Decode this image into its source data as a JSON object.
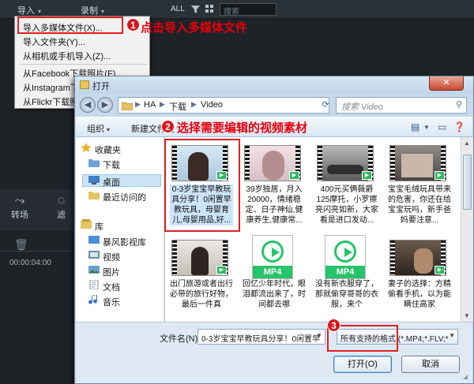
{
  "app": {
    "menu_import": "导入",
    "menu_record": "录制",
    "all_label": "ALL",
    "search_placeholder": "搜索",
    "strip_items": [
      "转场",
      "滤"
    ],
    "timecode": "00:00:04:00",
    "chevron": "▾"
  },
  "dropdown": {
    "items": [
      "导入多媒体文件(X)...",
      "导入文件夹(Y)...",
      "从相机或手机导入(Z)...",
      "从Facebook下载照片(F)...",
      "从Instagram下载照片(G)...",
      "从Flickr下载照片(H)..."
    ]
  },
  "annotations": {
    "step1_number": "1",
    "step1_text": "点击导入多媒体文件",
    "step2_number": "2",
    "step2_text": "选择需要编辑的视频素材",
    "step3_number": "3",
    "highlight_color": "#e02020"
  },
  "dialog": {
    "title": "打开",
    "close_label": "✕",
    "back_icon": "◀",
    "forward_icon": "▶",
    "breadcrumb": [
      "HA",
      "下载",
      "Video"
    ],
    "search_placeholder": "搜索 Video",
    "toolbar": {
      "organize": "组织",
      "new_folder": "新建文件夹"
    },
    "sidebar": {
      "favorites": "收藏夹",
      "items_fav": [
        "下载",
        "桌面",
        "最近访问的"
      ],
      "library": "库",
      "items_lib": [
        "暴风影视库",
        "视频",
        "图片",
        "文档",
        "音乐"
      ],
      "selected": "桌面"
    },
    "files": [
      {
        "label": "0-3岁宝宝早教玩具分享！0闲置早教玩具，母婴育儿,母婴用品,好...",
        "type": "video"
      },
      {
        "label": "39岁独居，月入20000，情绪稳定、日子神仙,健康养生,健康常...",
        "type": "video"
      },
      {
        "label": "400元买俩薇爵125摩托，小罗擦亮闪亮如新，大家看是进口发动...",
        "type": "video"
      },
      {
        "label": "宝宝毛绒玩具带来的危害，你还在给宝宝玩吗，新手爸妈要注意...",
        "type": "video"
      },
      {
        "label": "出门旅游或者出行必带的旅行好物，最后一件真",
        "type": "video"
      },
      {
        "label": "回忆少年时代，眼泪都流出来了，时间都去哪",
        "type": "mp4"
      },
      {
        "label": "没有新衣服穿了，那就偷穿哥哥的衣服，来个",
        "type": "mp4"
      },
      {
        "label": "妻子的选择：方精偷看手机，以为能瞒住高家",
        "type": "video"
      }
    ],
    "mp4_label": "MP4",
    "filename_label": "文件名(N):",
    "filename_value": "0-3岁宝宝早教玩具分享！0闲置早",
    "filter_value": "所有支持的格式 (*.MP4;*.FLV;*",
    "open_button": "打开(O)",
    "cancel_button": "取消"
  }
}
